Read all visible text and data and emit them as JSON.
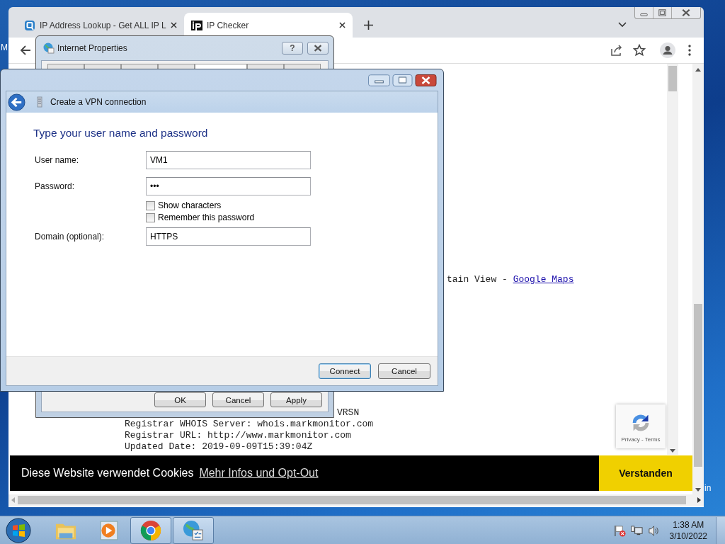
{
  "desktop": {
    "labels": [
      "M",
      "in"
    ]
  },
  "browser": {
    "tabs": [
      {
        "title": "IP Address Lookup - Get ALL IP L",
        "kind": "lookup",
        "selected": false
      },
      {
        "title": "IP Checker",
        "kind": "ip",
        "selected": true
      }
    ],
    "page": {
      "location": {
        "text": "tain View - ",
        "link": "Google Maps"
      },
      "whois_lines": [
        "VRSN",
        "Registrar WHOIS Server: whois.markmonitor.com",
        "Registrar URL: http://www.markmonitor.com",
        "Updated Date: 2019-09-09T15:39:04Z"
      ],
      "recaptcha": "Privacy - Terms",
      "cookie_bar": {
        "text": "Diese Website verwendet Cookies",
        "link": "Mehr Infos und Opt-Out",
        "button": "Verstanden"
      }
    }
  },
  "internet_properties": {
    "title": "Internet Properties",
    "help": "?",
    "tabs": [
      {
        "selected": false
      },
      {
        "selected": false
      },
      {
        "selected": false
      },
      {
        "selected": false
      },
      {
        "selected": true
      },
      {
        "selected": false
      },
      {
        "selected": false
      }
    ],
    "buttons": [
      "OK",
      "Cancel",
      "Apply"
    ]
  },
  "vpn_dialog": {
    "title": "Create a VPN connection",
    "heading": "Type your user name and password",
    "rows": [
      {
        "kind": "field",
        "label": "User name:",
        "value": "VM1"
      },
      {
        "kind": "field",
        "label": "Password:",
        "value": "•••"
      },
      {
        "kind": "checkbox",
        "label": "Show characters",
        "checked": false
      },
      {
        "kind": "checkbox",
        "label": "Remember this password",
        "checked": false
      },
      {
        "kind": "field",
        "label": "Domain (optional):",
        "value": "HTTPS"
      }
    ],
    "buttons": [
      {
        "label": "Connect",
        "default": true
      },
      {
        "label": "Cancel",
        "default": false
      }
    ]
  },
  "taskbar": {
    "apps": [
      {
        "kind": "explorer",
        "running": false
      },
      {
        "kind": "media",
        "running": false
      },
      {
        "kind": "chrome",
        "running": true
      },
      {
        "kind": "netprops",
        "running": true
      }
    ],
    "clock": {
      "time": "1:38 AM",
      "date": "3/10/2022"
    }
  }
}
